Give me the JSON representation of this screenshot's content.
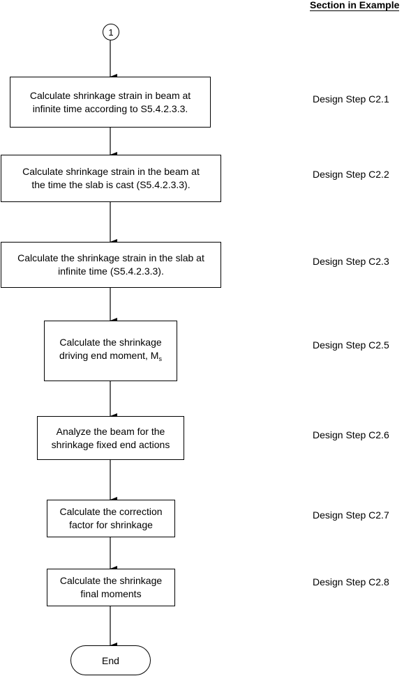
{
  "header": {
    "title": "Section in Example"
  },
  "start_connector": {
    "label": "1"
  },
  "steps": [
    {
      "text": "Calculate shrinkage strain in beam at infinite time according to S5.4.2.3.3.",
      "line1": "Calculate shrinkage strain in beam at",
      "line2": "infinite time according to S5.4.2.3.3.",
      "section": "Design Step C2.1"
    },
    {
      "text": "Calculate shrinkage strain in the beam at the time the slab is cast (S5.4.2.3.3).",
      "line1": "Calculate shrinkage strain in the beam at",
      "line2": "the time the slab is cast (S5.4.2.3.3).",
      "section": "Design Step C2.2"
    },
    {
      "text": "Calculate the shrinkage strain in the slab at infinite time (S5.4.2.3.3).",
      "line1": "Calculate the shrinkage strain in the slab at",
      "line2": "infinite time (S5.4.2.3.3).",
      "section": "Design Step C2.3"
    },
    {
      "text": "Calculate the shrinkage driving end moment, Ms",
      "line1": "Calculate the shrinkage",
      "line2": "driving end moment, M",
      "subscript": "s",
      "section": "Design Step C2.5"
    },
    {
      "text": "Analyze the beam for the shrinkage fixed end actions",
      "line1": "Analyze the beam for the",
      "line2": "shrinkage fixed end actions",
      "section": "Design Step C2.6"
    },
    {
      "text": "Calculate the correction factor for shrinkage",
      "line1": "Calculate the correction",
      "line2": "factor for shrinkage",
      "section": "Design Step C2.7"
    },
    {
      "text": "Calculate the shrinkage final moments",
      "line1": "Calculate the shrinkage",
      "line2": "final moments",
      "section": "Design Step C2.8"
    }
  ],
  "end": {
    "label": "End"
  }
}
